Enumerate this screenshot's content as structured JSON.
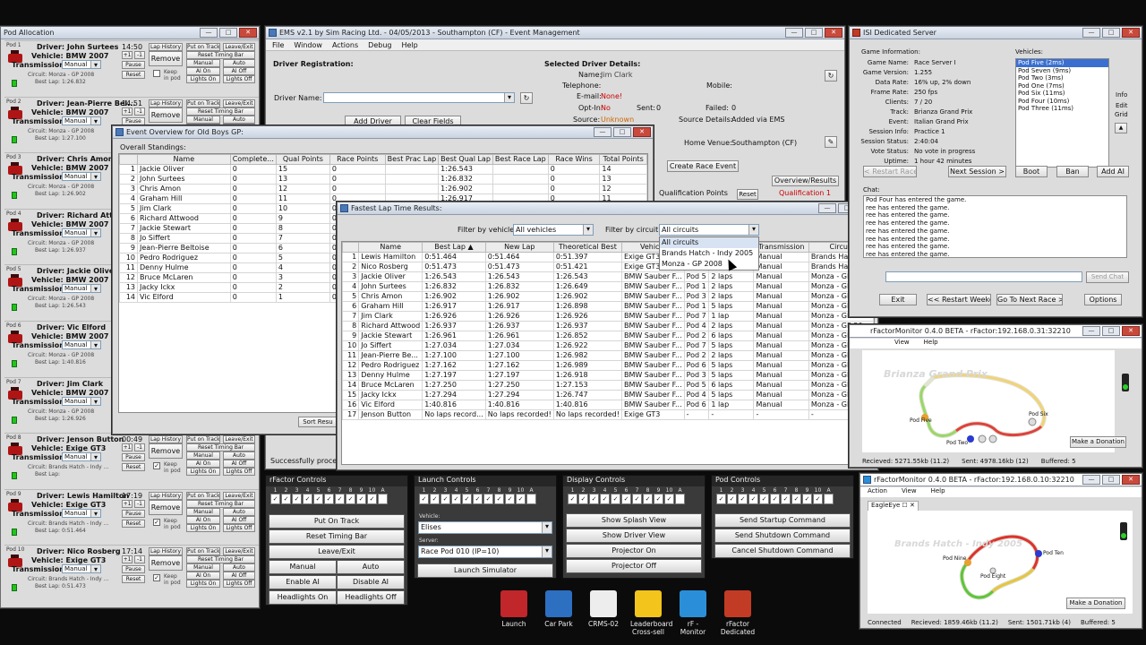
{
  "pod_allocation": {
    "title": "Pod Allocation",
    "pods": [
      {
        "pod": "Pod 1",
        "driver": "Driver: John Surtees",
        "time": "14:50",
        "vehicle": "Vehicle: BMW 2007",
        "transmission": "Manual",
        "circuit": "Circuit: Monza - GP 2008",
        "best": "Best Lap: 1:26.832",
        "keep": false
      },
      {
        "pod": "Pod 2",
        "driver": "Driver: Jean-Pierre Bel...",
        "time": "14:51",
        "vehicle": "Vehicle: BMW 2007",
        "transmission": "Manual",
        "circuit": "Circuit: Monza - GP 2008",
        "best": "Best Lap: 1:27.100",
        "keep": false
      },
      {
        "pod": "Pod 3",
        "driver": "Driver: Chris Amon",
        "time": "",
        "vehicle": "Vehicle: BMW 2007",
        "transmission": "Manual",
        "circuit": "Circuit: Monza - GP 2008",
        "best": "Best Lap: 1:26.902",
        "keep": false
      },
      {
        "pod": "Pod 4",
        "driver": "Driver: Richard Attwood",
        "time": "",
        "vehicle": "Vehicle: BMW 2007",
        "transmission": "Manual",
        "circuit": "Circuit: Monza - GP 2008",
        "best": "Best Lap: 1:26.937",
        "keep": false
      },
      {
        "pod": "Pod 5",
        "driver": "Driver: Jackie Oliver",
        "time": "",
        "vehicle": "Vehicle: BMW 2007",
        "transmission": "Manual",
        "circuit": "Circuit: Monza - GP 2008",
        "best": "Best Lap: 1:26.543",
        "keep": false
      },
      {
        "pod": "Pod 6",
        "driver": "Driver: Vic Elford",
        "time": "",
        "vehicle": "Vehicle: BMW 2007",
        "transmission": "Manual",
        "circuit": "Circuit: Monza - GP 2008",
        "best": "Best Lap: 1:40.816",
        "keep": false
      },
      {
        "pod": "Pod 7",
        "driver": "Driver: Jim Clark",
        "time": "",
        "vehicle": "Vehicle: BMW 2007",
        "transmission": "Manual",
        "circuit": "Circuit: Monza - GP 2008",
        "best": "Best Lap: 1:26.926",
        "keep": false
      },
      {
        "pod": "Pod 8",
        "driver": "Driver: Jenson Button",
        "time": "00:49",
        "vehicle": "Vehicle: Exige GT3",
        "transmission": "Manual",
        "circuit": "Circuit: Brands Hatch - Indy ...",
        "best": "Best Lap:",
        "keep": true
      },
      {
        "pod": "Pod 9",
        "driver": "Driver: Lewis Hamilton",
        "time": "17:19",
        "vehicle": "Vehicle: Exige GT3",
        "transmission": "Manual",
        "circuit": "Circuit: Brands Hatch - Indy ...",
        "best": "Best Lap: 0:51.464",
        "keep": true
      },
      {
        "pod": "Pod 10",
        "driver": "Driver: Nico Rosberg",
        "time": "17:14",
        "vehicle": "Vehicle: Exige GT3",
        "transmission": "Manual",
        "circuit": "Circuit: Brands Hatch - Indy ...",
        "best": "Best Lap: 0:51.473",
        "keep": true
      }
    ],
    "buttons": {
      "lap_history": "Lap History",
      "put_on_track": "Put on Track",
      "leave_exit": "Leave/Exit",
      "reset_timing": "Reset Timing Bar",
      "remove": "Remove",
      "manual": "Manual",
      "auto": "Auto",
      "ai_on": "AI On",
      "ai_off": "AI Off",
      "lights_on": "Lights On",
      "lights_off": "Lights Off",
      "pause": "Pause",
      "reset": "Reset",
      "plus": "+1",
      "minus": "-1",
      "keep_in_pod": "Keep in pod",
      "transmission_label": "Transmission:"
    }
  },
  "ems": {
    "title": "EMS v2.1 by Sim Racing Ltd. - 04/05/2013 - Southampton (CF) - Event Management",
    "menu": [
      "File",
      "Window",
      "Actions",
      "Debug",
      "Help"
    ],
    "driver_registration": "Driver Registration:",
    "driver_name_label": "Driver Name:",
    "add_driver": "Add Driver",
    "clear_fields": "Clear Fields",
    "selected_driver": "Selected Driver Details:",
    "name_label": "Name:",
    "name_value": "Jim Clark",
    "telephone_label": "Telephone:",
    "mobile_label": "Mobile:",
    "email_label": "E-mail:",
    "email_value": "None!",
    "optin_label": "Opt-In:",
    "optin_value": "No",
    "sent_label": "Sent:",
    "sent_value": "0",
    "failed_label": "Failed:",
    "failed_value": "0",
    "source_label": "Source:",
    "source_value": "Unknown",
    "source_details_label": "Source Details:",
    "source_details_value": "Added via EMS",
    "home_venue_label": "Home Venue:",
    "home_venue_value": "Southampton (CF)",
    "create_race_event": "Create Race Event",
    "overview_results": "Overview/Results",
    "qualification_points": "Qualification Points",
    "reset": "Reset",
    "qualification_1": "Qualification 1",
    "status": "Successfully proce"
  },
  "event_overview": {
    "title": "Event Overview for Old Boys GP:",
    "heading": "Overall Standings:",
    "columns": [
      "",
      "Name",
      "Complete...",
      "Qual Points",
      "Race Points",
      "Best Prac Lap",
      "Best Qual Lap",
      "Best Race Lap",
      "Race Wins",
      "Total Points"
    ],
    "rows": [
      [
        "1",
        "Jackie Oliver",
        "0",
        "15",
        "0",
        "",
        "1:26.543",
        "",
        "0",
        "14"
      ],
      [
        "2",
        "John Surtees",
        "0",
        "13",
        "0",
        "",
        "1:26.832",
        "",
        "0",
        "13"
      ],
      [
        "3",
        "Chris Amon",
        "0",
        "12",
        "0",
        "",
        "1:26.902",
        "",
        "0",
        "12"
      ],
      [
        "4",
        "Graham Hill",
        "0",
        "11",
        "0",
        "",
        "1:26.917",
        "",
        "0",
        "11"
      ],
      [
        "5",
        "Jim Clark",
        "0",
        "10",
        "0",
        "",
        "",
        "",
        "",
        ""
      ],
      [
        "6",
        "Richard Attwood",
        "0",
        "9",
        "0",
        "",
        "",
        "",
        "",
        ""
      ],
      [
        "7",
        "Jackie Stewart",
        "0",
        "8",
        "0",
        "",
        "",
        "",
        "",
        ""
      ],
      [
        "8",
        "Jo Siffert",
        "0",
        "7",
        "0",
        "",
        "",
        "",
        "",
        ""
      ],
      [
        "9",
        "Jean-Pierre Beltoise",
        "0",
        "6",
        "0",
        "",
        "",
        "",
        "",
        ""
      ],
      [
        "10",
        "Pedro Rodriguez",
        "0",
        "5",
        "0",
        "",
        "",
        "",
        "",
        ""
      ],
      [
        "11",
        "Denny Hulme",
        "0",
        "4",
        "0",
        "",
        "",
        "",
        "",
        ""
      ],
      [
        "12",
        "Bruce McLaren",
        "0",
        "3",
        "0",
        "",
        "",
        "",
        "",
        ""
      ],
      [
        "13",
        "Jacky Ickx",
        "0",
        "2",
        "0",
        "",
        "",
        "",
        "",
        ""
      ],
      [
        "14",
        "Vic Elford",
        "0",
        "1",
        "0",
        "",
        "",
        "",
        "",
        ""
      ]
    ],
    "sort_button": "Sort Resu"
  },
  "fastest_lap": {
    "title": "Fastest Lap Time Results:",
    "filter_vehicle_label": "Filter by vehicle:",
    "filter_vehicle_value": "All vehicles",
    "filter_circuit_label": "Filter by circuit:",
    "filter_circuit_value": "All circuits",
    "dropdown_options": [
      "All circuits",
      "Brands Hatch - Indy 2005",
      "Monza - GP 2008"
    ],
    "columns": [
      "",
      "Name",
      "Best Lap ▲",
      "New Lap",
      "Theoretical Best",
      "Vehicle",
      "",
      "Pod",
      "Transmission",
      "Circuit"
    ],
    "rows": [
      [
        "1",
        "Lewis Hamilton",
        "0:51.464",
        "0:51.464",
        "0:51.397",
        "Exige GT3",
        "Po",
        "",
        "Manual",
        "Brands Hatch -..."
      ],
      [
        "2",
        "Nico Rosberg",
        "0:51.473",
        "0:51.473",
        "0:51.421",
        "Exige GT3",
        "Po",
        "",
        "Manual",
        "Brands Hatch -..."
      ],
      [
        "3",
        "Jackie Oliver",
        "1:26.543",
        "1:26.543",
        "1:26.543",
        "BMW Sauber F...",
        "Pod 5",
        "2 laps",
        "Manual",
        "Monza - GP 20..."
      ],
      [
        "4",
        "John Surtees",
        "1:26.832",
        "1:26.832",
        "1:26.649",
        "BMW Sauber F...",
        "Pod 1",
        "2 laps",
        "Manual",
        "Monza - GP 20..."
      ],
      [
        "5",
        "Chris Amon",
        "1:26.902",
        "1:26.902",
        "1:26.902",
        "BMW Sauber F...",
        "Pod 3",
        "2 laps",
        "Manual",
        "Monza - GP 20..."
      ],
      [
        "6",
        "Graham Hill",
        "1:26.917",
        "1:26.917",
        "1:26.898",
        "BMW Sauber F...",
        "Pod 1",
        "5 laps",
        "Manual",
        "Monza - GP 20..."
      ],
      [
        "7",
        "Jim Clark",
        "1:26.926",
        "1:26.926",
        "1:26.926",
        "BMW Sauber F...",
        "Pod 7",
        "1 lap",
        "Manual",
        "Monza - GP 20..."
      ],
      [
        "8",
        "Richard Attwood",
        "1:26.937",
        "1:26.937",
        "1:26.937",
        "BMW Sauber F...",
        "Pod 4",
        "2 laps",
        "Manual",
        "Monza - GP 20..."
      ],
      [
        "9",
        "Jackie Stewart",
        "1:26.961",
        "1:26.961",
        "1:26.852",
        "BMW Sauber F...",
        "Pod 2",
        "6 laps",
        "Manual",
        "Monza - GP 20..."
      ],
      [
        "10",
        "Jo Siffert",
        "1:27.034",
        "1:27.034",
        "1:26.922",
        "BMW Sauber F...",
        "Pod 7",
        "5 laps",
        "Manual",
        "Monza - GP 20..."
      ],
      [
        "11",
        "Jean-Pierre Be...",
        "1:27.100",
        "1:27.100",
        "1:26.982",
        "BMW Sauber F...",
        "Pod 2",
        "2 laps",
        "Manual",
        "Monza - GP 20..."
      ],
      [
        "12",
        "Pedro Rodriguez",
        "1:27.162",
        "1:27.162",
        "1:26.989",
        "BMW Sauber F...",
        "Pod 6",
        "5 laps",
        "Manual",
        "Monza - GP 20..."
      ],
      [
        "13",
        "Denny Hulme",
        "1:27.197",
        "1:27.197",
        "1:26.918",
        "BMW Sauber F...",
        "Pod 3",
        "5 laps",
        "Manual",
        "Monza - GP 20..."
      ],
      [
        "14",
        "Bruce McLaren",
        "1:27.250",
        "1:27.250",
        "1:27.153",
        "BMW Sauber F...",
        "Pod 5",
        "6 laps",
        "Manual",
        "Monza - GP 20..."
      ],
      [
        "15",
        "Jacky Ickx",
        "1:27.294",
        "1:27.294",
        "1:26.747",
        "BMW Sauber F...",
        "Pod 4",
        "5 laps",
        "Manual",
        "Monza - GP 20..."
      ],
      [
        "16",
        "Vic Elford",
        "1:40.816",
        "1:40.816",
        "1:40.816",
        "BMW Sauber F...",
        "Pod 6",
        "1 lap",
        "Manual",
        "Monza - GP 20..."
      ],
      [
        "17",
        "Jenson Button",
        "No laps record...",
        "No laps recorded!",
        "No laps recorded!",
        "Exige GT3",
        "-",
        "-",
        "-",
        "-"
      ]
    ]
  },
  "isi": {
    "title": "ISI Dedicated Server",
    "game_info_label": "Game Information:",
    "fields": [
      [
        "Game Name:",
        "Race Server I"
      ],
      [
        "Game Version:",
        "1.255"
      ],
      [
        "Data Rate:",
        "16% up, 2% down"
      ],
      [
        "Frame Rate:",
        "250 fps"
      ],
      [
        "Clients:",
        "7 / 20"
      ],
      [
        "Track:",
        "Brianza Grand Prix"
      ],
      [
        "Event:",
        "Italian Grand Prix"
      ],
      [
        "Session Info:",
        "Practice 1"
      ],
      [
        "Session Status:",
        "2:40:04"
      ],
      [
        "Vote Status:",
        "No vote in progress"
      ],
      [
        "Uptime:",
        "1 hour 42 minutes"
      ]
    ],
    "vehicles_label": "Vehicles:",
    "vehicles": [
      "Pod Five (2ms)",
      "Pod Seven (9ms)",
      "Pod Two (3ms)",
      "Pod One (7ms)",
      "Pod Six (11ms)",
      "Pod Four (10ms)",
      "Pod Three (11ms)"
    ],
    "side_buttons": [
      "Info",
      "Edit",
      "Grid"
    ],
    "restart_race": "< Restart Race",
    "next_session": "Next Session >",
    "boot": "Boot",
    "ban": "Ban",
    "add_ai": "Add AI",
    "chat_label": "Chat:",
    "chat_lines": [
      "Pod Four has entered the game.",
      "ree has entered the game.",
      "ree has entered the game.",
      "ree has entered the game.",
      "ree has entered the game.",
      "ree has entered the game.",
      "ree has entered the game.",
      "ree has entered the game.",
      "ree has entered the game."
    ],
    "send_chat": "Send Chat",
    "exit": "Exit",
    "restart_weekend": "<< Restart Weekend",
    "next_race": "Go To Next Race >>",
    "options": "Options"
  },
  "rfmon1": {
    "title": "rFactorMonitor 0.4.0 BETA - rFactor:192.168.0.31:32210",
    "menu": [
      "View",
      "Help"
    ],
    "track_name": "Brianza Grand Prix",
    "pod_five": "Pod Five",
    "pod_six": "Pod Six",
    "pod_two": "Pod Two",
    "donation": "Make a Donation",
    "status": [
      "Recieved: 5271.55kb (11.2)",
      "Sent: 4978.16kb (12)",
      "Buffered: 5"
    ]
  },
  "rfmon2": {
    "title": "rFactorMonitor 0.4.0 BETA - rFactor:192.168.0.10:32210",
    "menu": [
      "Action",
      "View",
      "Help"
    ],
    "tab": "EagleEye",
    "track_name": "Brands Hatch - Indy 2005",
    "pod_nine": "Pod Nine",
    "pod_ten": "Pod Ten",
    "pod_eight": "Pod Eight",
    "donation": "Make a Donation",
    "status": [
      "Connected",
      "Recieved: 1859.46kb (11.2)",
      "Sent: 1501.71kb (4)",
      "Buffered: 5"
    ]
  },
  "rfactor_controls": {
    "title": "rFactor Controls",
    "buttons": [
      "Put On Track",
      "Reset Timing Bar",
      "Leave/Exit",
      "Manual",
      "Auto",
      "Enable AI",
      "Disable AI",
      "Headlights On",
      "Headlights Off"
    ]
  },
  "launch_controls": {
    "title": "Launch Controls",
    "vehicle_label": "Vehicle:",
    "vehicle_value": "Elises",
    "server_label": "Server:",
    "server_value": "Race Pod 010 (IP=10)",
    "launch": "Launch Simulator"
  },
  "display_controls": {
    "title": "Display Controls",
    "buttons": [
      "Show Splash View",
      "Show Driver View",
      "Projector On",
      "Projector Off"
    ]
  },
  "pod_controls": {
    "title": "Pod Controls",
    "buttons": [
      "Send Startup Command",
      "Send Shutdown Command",
      "Cancel Shutdown Command"
    ]
  },
  "checkbox_numbers": [
    "1",
    "2",
    "3",
    "4",
    "5",
    "6",
    "7",
    "8",
    "9",
    "10"
  ],
  "checkbox_all": "A",
  "taskbar": [
    {
      "label": "Launch",
      "color": "#c0262a",
      "icon": "ems-launch-icon"
    },
    {
      "label": "Car Park",
      "color": "#2d6fc0",
      "icon": "car-park-icon"
    },
    {
      "label": "CRMS-02",
      "color": "#ededed",
      "icon": "crms-icon"
    },
    {
      "label": "Leaderboard Cross-sell",
      "color": "#f2c41c",
      "icon": "star-icon"
    },
    {
      "label": "rF - Monitor",
      "color": "#2a8fd8",
      "icon": "rf-monitor-icon"
    },
    {
      "label": "rFactor Dedicated",
      "color": "#c23b25",
      "icon": "rfactor-icon"
    }
  ]
}
